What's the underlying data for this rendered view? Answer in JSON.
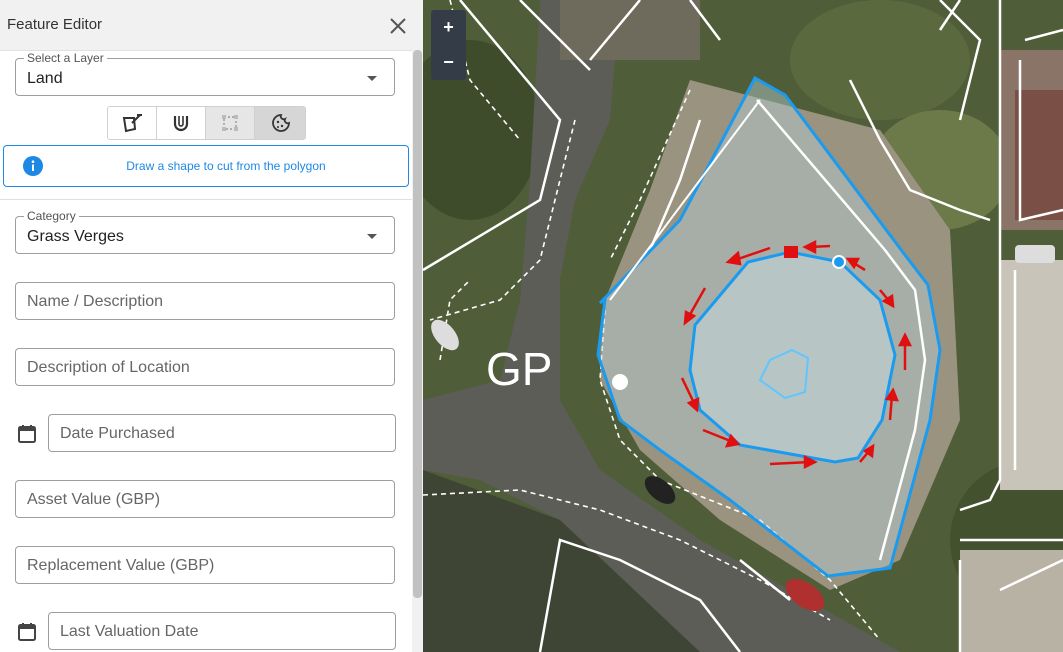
{
  "panel": {
    "title": "Feature Editor",
    "layer_select": {
      "legend": "Select a Layer",
      "value": "Land"
    },
    "tools": [
      "draw-polygon-icon",
      "snap-magnet-icon",
      "bounding-box-icon",
      "cookie-cutter-icon"
    ],
    "info_message": "Draw a shape to cut from the polygon",
    "category_select": {
      "legend": "Category",
      "value": "Grass Verges"
    },
    "fields": {
      "name_description": "Name / Description",
      "description_location": "Description of Location",
      "date_purchased": "Date Purchased",
      "asset_value": "Asset Value (GBP)",
      "replacement_value": "Replacement Value (GBP)",
      "last_valuation_date": "Last Valuation Date"
    }
  },
  "map": {
    "zoom_in": "+",
    "zoom_out": "−",
    "map_label": "GP",
    "colors": {
      "polygon_outline": "#1a9bf0",
      "cut_arrows": "#e01010"
    }
  }
}
